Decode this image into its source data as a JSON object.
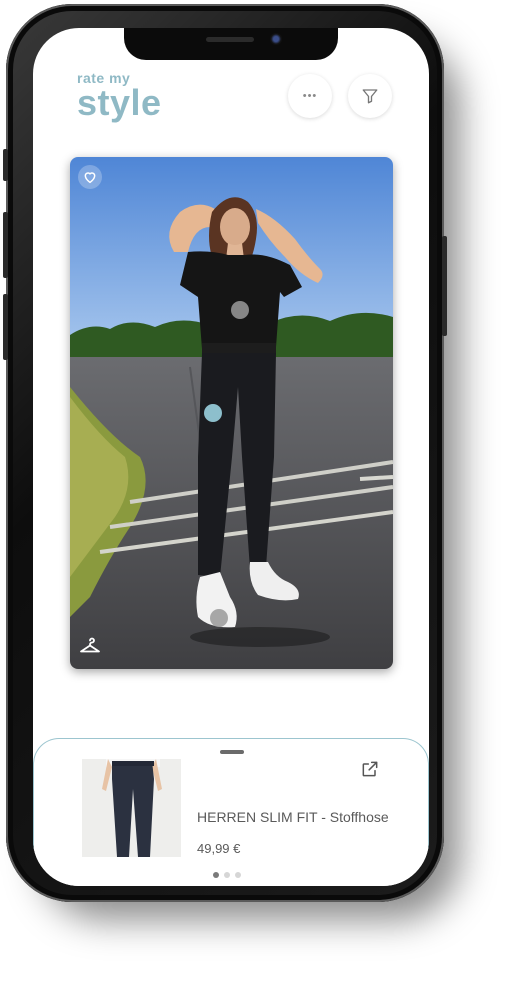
{
  "app": {
    "logo_small": "rate my",
    "logo_big": "style"
  },
  "header": {
    "more_icon": "more-horizontal-icon",
    "more_label": "•••",
    "filter_icon": "filter-funnel-icon"
  },
  "outfit": {
    "favorite_icon": "heart-icon",
    "wardrobe_icon": "hanger-icon",
    "hotspot_colors": {
      "top": "#9a9a9a",
      "pants": "#8dbfcc",
      "shoes": "#9a9a9a"
    }
  },
  "product_sheet": {
    "title": "HERREN SLIM FIT  - Stoffhose",
    "price": "49,99 €",
    "external_icon": "external-link-icon",
    "page_count": 3,
    "active_page": 1
  },
  "colors": {
    "accent": "#8fb9c5",
    "sheet_border": "#9cc5cf"
  }
}
